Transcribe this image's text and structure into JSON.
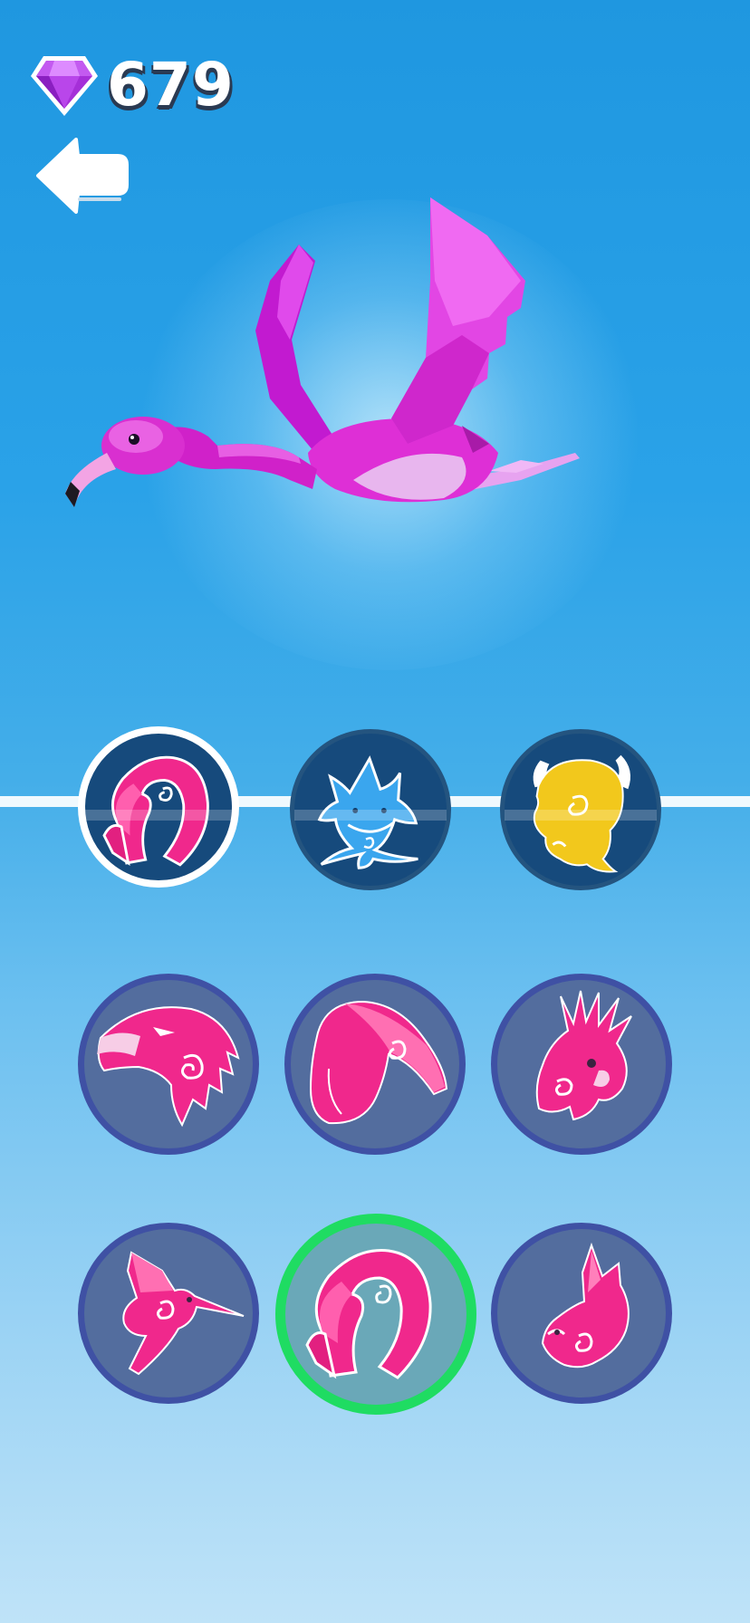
{
  "header": {
    "gem_count": "679",
    "gem_icon": "purple-gem-icon",
    "back_icon": "back-arrow-icon"
  },
  "colors": {
    "background_top": "#1f97e0",
    "background_bottom": "#bfe3f8",
    "flamingo_pink": "#e01cd8",
    "animal_pink": "#f0288c",
    "selected_border": "#ffffff",
    "equipped_border": "#1fdc62",
    "gold": "#f2c81c",
    "shark_blue": "#3aa6ee"
  },
  "preview": {
    "character": "flamingo"
  },
  "animal_types": [
    {
      "icon": "flamingo-icon",
      "selected": true
    },
    {
      "icon": "shark-icon",
      "selected": false
    },
    {
      "icon": "buffalo-icon",
      "selected": false
    }
  ],
  "skins": [
    {
      "icon": "eagle-icon",
      "equipped": false
    },
    {
      "icon": "toucan-icon",
      "equipped": false
    },
    {
      "icon": "cockatoo-icon",
      "equipped": false
    },
    {
      "icon": "hummingbird-icon",
      "equipped": false
    },
    {
      "icon": "flamingo-icon",
      "equipped": true
    },
    {
      "icon": "rabbit-icon",
      "equipped": false
    }
  ]
}
